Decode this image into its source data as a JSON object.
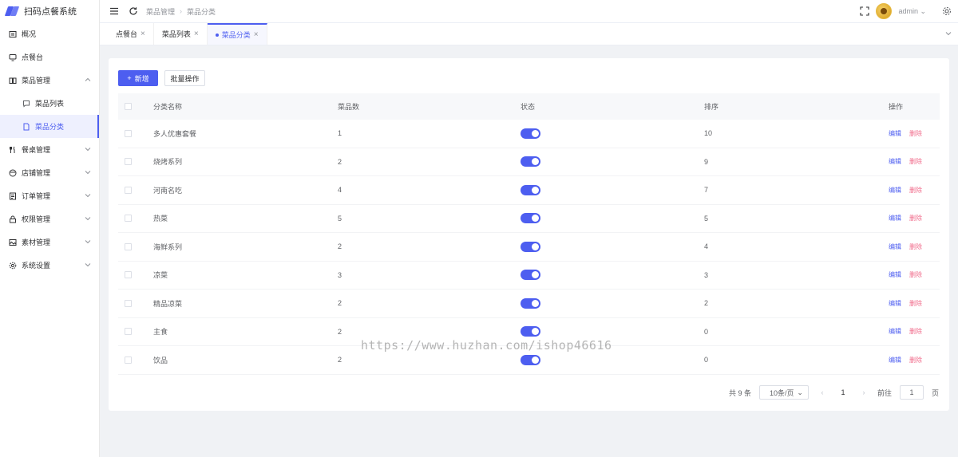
{
  "app": {
    "title": "扫码点餐系统",
    "brand_color": "#4d5ef0"
  },
  "sidebar": {
    "items": [
      {
        "label": "概况",
        "icon": "dashboard-icon"
      },
      {
        "label": "点餐台",
        "icon": "monitor-icon"
      },
      {
        "label": "菜品管理",
        "icon": "book-icon",
        "expanded": true
      },
      {
        "label": "菜品列表",
        "icon": "message-icon"
      },
      {
        "label": "菜品分类",
        "icon": "document-icon",
        "active": true
      },
      {
        "label": "餐桌管理",
        "icon": "utensils-icon"
      },
      {
        "label": "店铺管理",
        "icon": "store-icon"
      },
      {
        "label": "订单管理",
        "icon": "order-icon"
      },
      {
        "label": "权限管理",
        "icon": "lock-icon"
      },
      {
        "label": "素材管理",
        "icon": "image-icon"
      },
      {
        "label": "系统设置",
        "icon": "gear-icon"
      }
    ]
  },
  "header": {
    "breadcrumb": [
      "菜品管理",
      "菜品分类"
    ],
    "user": "admin"
  },
  "tabs": [
    {
      "label": "点餐台"
    },
    {
      "label": "菜品列表"
    },
    {
      "label": "菜品分类",
      "active": true
    }
  ],
  "toolbar": {
    "add_label": "新增",
    "batch_label": "批量操作"
  },
  "table": {
    "columns": [
      "分类名称",
      "菜品数",
      "状态",
      "排序",
      "操作"
    ],
    "rows": [
      {
        "name": "多人优惠套餐",
        "count": "1",
        "status": true,
        "sort": "10"
      },
      {
        "name": "烧烤系列",
        "count": "2",
        "status": true,
        "sort": "9"
      },
      {
        "name": "河南名吃",
        "count": "4",
        "status": true,
        "sort": "7"
      },
      {
        "name": "热菜",
        "count": "5",
        "status": true,
        "sort": "5"
      },
      {
        "name": "海鲜系列",
        "count": "2",
        "status": true,
        "sort": "4"
      },
      {
        "name": "凉菜",
        "count": "3",
        "status": true,
        "sort": "3"
      },
      {
        "name": "精品凉菜",
        "count": "2",
        "status": true,
        "sort": "2"
      },
      {
        "name": "主食",
        "count": "2",
        "status": true,
        "sort": "0"
      },
      {
        "name": "饮品",
        "count": "2",
        "status": true,
        "sort": "0"
      }
    ],
    "edit_label": "编辑",
    "delete_label": "删除"
  },
  "pagination": {
    "total": "共 9 条",
    "page_size": "10条/页",
    "current": "1",
    "goto_label": "前往",
    "goto_value": "1",
    "page_suffix": "页"
  },
  "watermark": "https://www.huzhan.com/ishop46616"
}
